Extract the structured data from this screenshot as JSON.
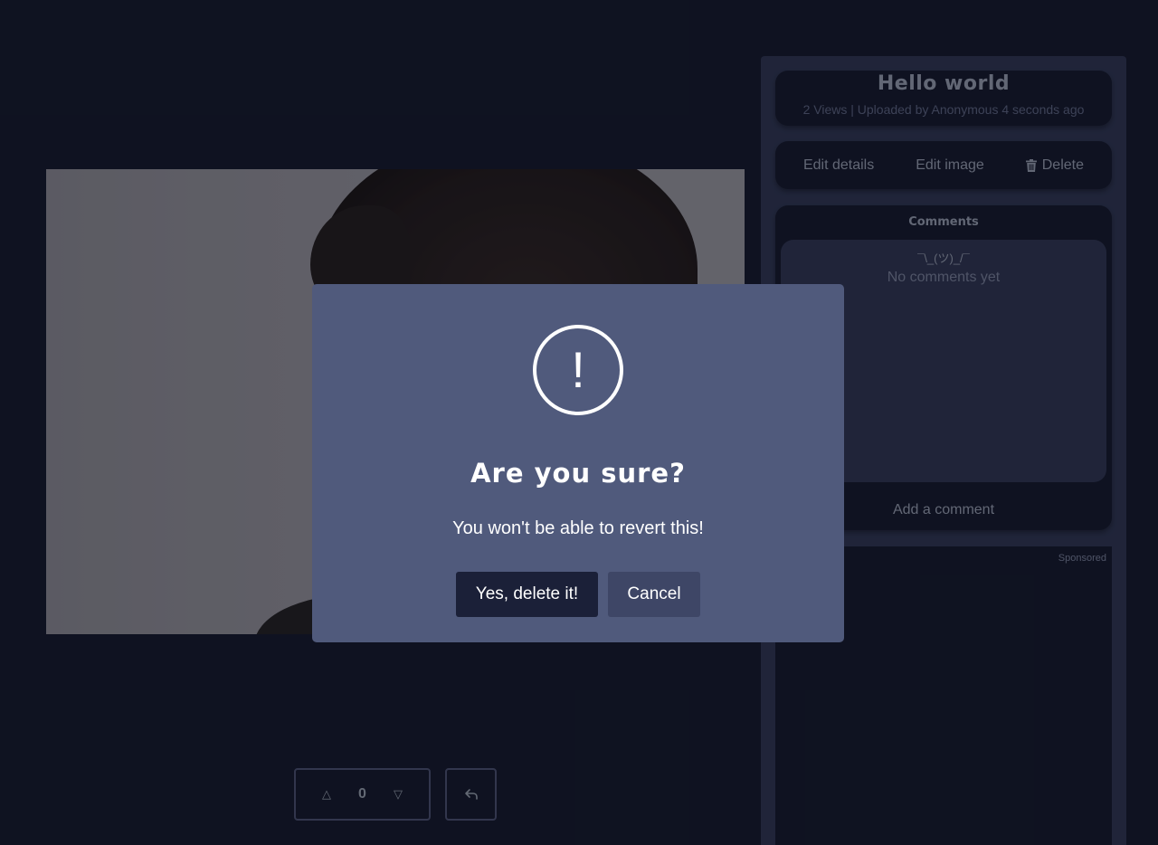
{
  "post": {
    "title": "Hello world",
    "meta": "2 Views | Uploaded by Anonymous 4 seconds ago"
  },
  "actions": {
    "edit_details": "Edit details",
    "edit_image": "Edit image",
    "delete": "Delete"
  },
  "comments": {
    "heading": "Comments",
    "shrug": "¯\\_(ツ)_/¯",
    "empty": "No comments yet",
    "add": "Add a comment"
  },
  "sponsored": {
    "label": "Sponsored"
  },
  "votes": {
    "count": "0"
  },
  "dialog": {
    "icon": "!",
    "title": "Are you sure?",
    "text": "You won't be able to revert this!",
    "confirm": "Yes, delete it!",
    "cancel": "Cancel"
  },
  "colors": {
    "background": "#141829",
    "sidebar": "#2f3550",
    "dialog": "#505a7c",
    "confirm_button": "#1b2038",
    "cancel_button": "#3e4666"
  }
}
